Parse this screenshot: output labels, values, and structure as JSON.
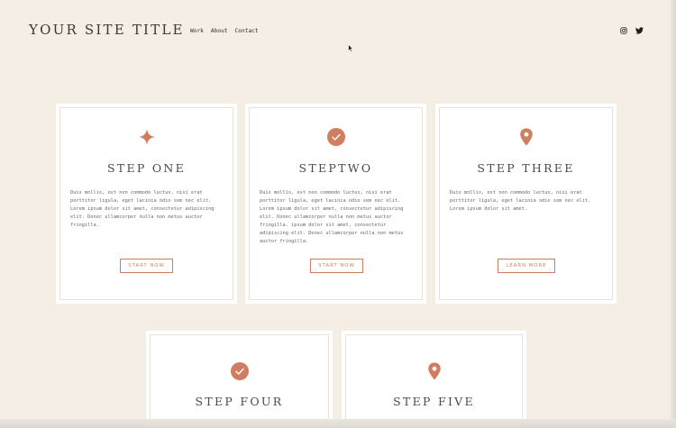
{
  "header": {
    "site_title": "YOUR SITE TITLE",
    "nav": [
      "Work",
      "About",
      "Contact"
    ],
    "social_icons": [
      "instagram-icon",
      "twitter-icon"
    ]
  },
  "cards": [
    {
      "icon": "sparkle-icon",
      "title": "STEP ONE",
      "body": "Duis mollis, est non commodo luctus, nisi erat porttitor ligula, eget lacinia odio sem nec elit. Lorem ipsum dolor sit amet, consectetur adipiscing elit. Donec ullamcorper nulla non metus auctor fringilla.",
      "button": "START NOW"
    },
    {
      "icon": "check-circle-icon",
      "title": "STEPTWO",
      "body": "Duis mollis, est non commodo luctus, nisi erat porttitor ligula, eget lacinia odio sem nec elit. Lorem ipsum dolor sit amet, consectetur adipiscing elit. Donec ullamcorper nulla non metus auctor fringilla. ipsum dolor sit amet, consectetur adipiscing elit. Donec ullamcorper nulla non metus auctor fringilla.",
      "button": "START NOW"
    },
    {
      "icon": "map-pin-icon",
      "title": "STEP THREE",
      "body": "Duis mollis, est non commodo luctus, nisi erat porttitor ligula, eget lacinia odio sem nec elit. Lorem ipsum dolor sit amet.",
      "button": "LEARN MORE"
    },
    {
      "icon": "check-circle-icon",
      "title": "STEP FOUR"
    },
    {
      "icon": "map-pin-icon",
      "title": "STEP FIVE"
    }
  ],
  "colors": {
    "background": "#f5eee5",
    "accent": "#cf7e62",
    "card": "#ffffff",
    "text": "#3c3833"
  }
}
